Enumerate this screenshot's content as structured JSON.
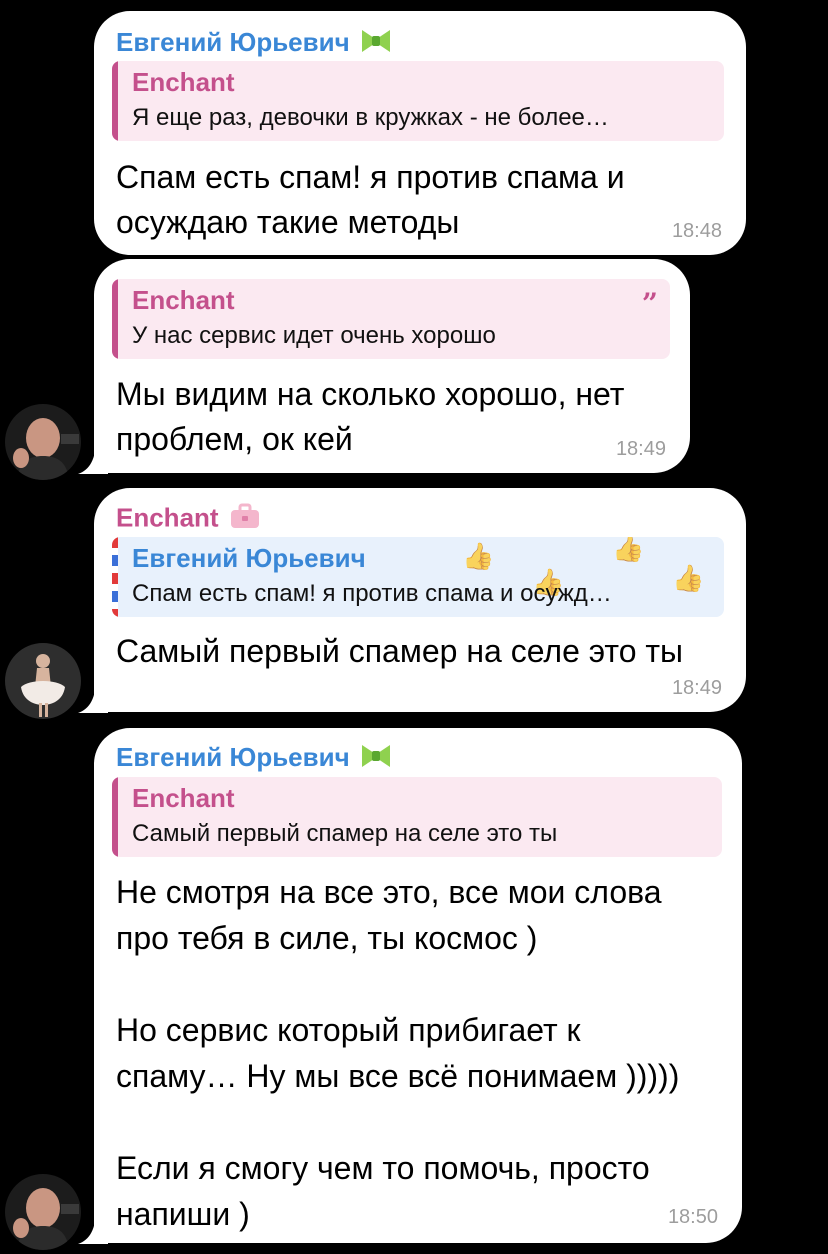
{
  "messages": [
    {
      "sender": "Евгений Юрьевич",
      "reply": {
        "name": "Enchant",
        "text": "Я еще раз, девочки в кружках - не более…"
      },
      "text": "Спам есть спам! я против спама и\nосуждаю такие методы",
      "time": "18:48"
    },
    {
      "reply": {
        "name": "Enchant",
        "text": "У нас сервис идет очень хорошо"
      },
      "text": "Мы видим на сколько хорошо, нет\nпроблем, ок кей",
      "time": "18:49"
    },
    {
      "sender": "Enchant",
      "reply": {
        "name": "Евгений Юрьевич",
        "text": "Спам есть спам! я против спама и осужд…"
      },
      "text": "Самый первый спамер на селе это ты",
      "time": "18:49"
    },
    {
      "sender": "Евгений Юрьевич",
      "reply": {
        "name": "Enchant",
        "text": "Самый первый спамер на селе это ты"
      },
      "text": "Не смотря на все это, все мои слова\nпро тебя в силе, ты космос )\n\nНо сервис который прибигает к\nспаму… Ну мы все всё понимаем )))))\n\nЕсли я смогу чем то помочь, просто\nнапиши )",
      "time": "18:50"
    }
  ],
  "colors": {
    "background": "#000000",
    "bubble": "#ffffff",
    "blue_name": "#3a87d6",
    "pink_name": "#c4508c",
    "time": "#9d9d9d"
  },
  "icons": [
    "green-bow-badge-icon",
    "briefcase-badge-icon",
    "quote-icon"
  ]
}
